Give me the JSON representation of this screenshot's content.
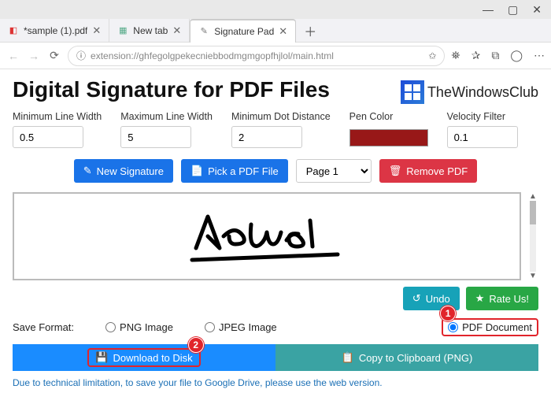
{
  "browser": {
    "tabs": [
      {
        "label": "*sample (1).pdf"
      },
      {
        "label": "New tab"
      },
      {
        "label": "Signature Pad"
      }
    ],
    "address": "extension://ghfegolgpekecniebbodmgmgopfhjlol/main.html"
  },
  "page": {
    "title": "Digital Signature for PDF Files",
    "brand": "TheWindowsClub"
  },
  "controls": {
    "minLine": {
      "label": "Minimum Line Width",
      "value": "0.5"
    },
    "maxLine": {
      "label": "Maximum Line Width",
      "value": "5"
    },
    "minDot": {
      "label": "Minimum Dot Distance",
      "value": "2"
    },
    "penColor": {
      "label": "Pen Color",
      "value": "#981818"
    },
    "velocity": {
      "label": "Velocity Filter",
      "value": "0.1"
    }
  },
  "actions": {
    "newSig": "New Signature",
    "pickPdf": "Pick a PDF File",
    "pageSelect": "Page 1",
    "removePdf": "Remove PDF",
    "undo": "Undo",
    "rateUs": "Rate Us!"
  },
  "format": {
    "label": "Save Format:",
    "png": "PNG Image",
    "jpeg": "JPEG Image",
    "pdf": "PDF Document",
    "selected": "pdf"
  },
  "bottom": {
    "download": "Download to Disk",
    "copy": "Copy to Clipboard (PNG)",
    "note": "Due to technical limitation, to save your file to Google Drive, please use the web version."
  },
  "callouts": {
    "one": "1",
    "two": "2"
  }
}
